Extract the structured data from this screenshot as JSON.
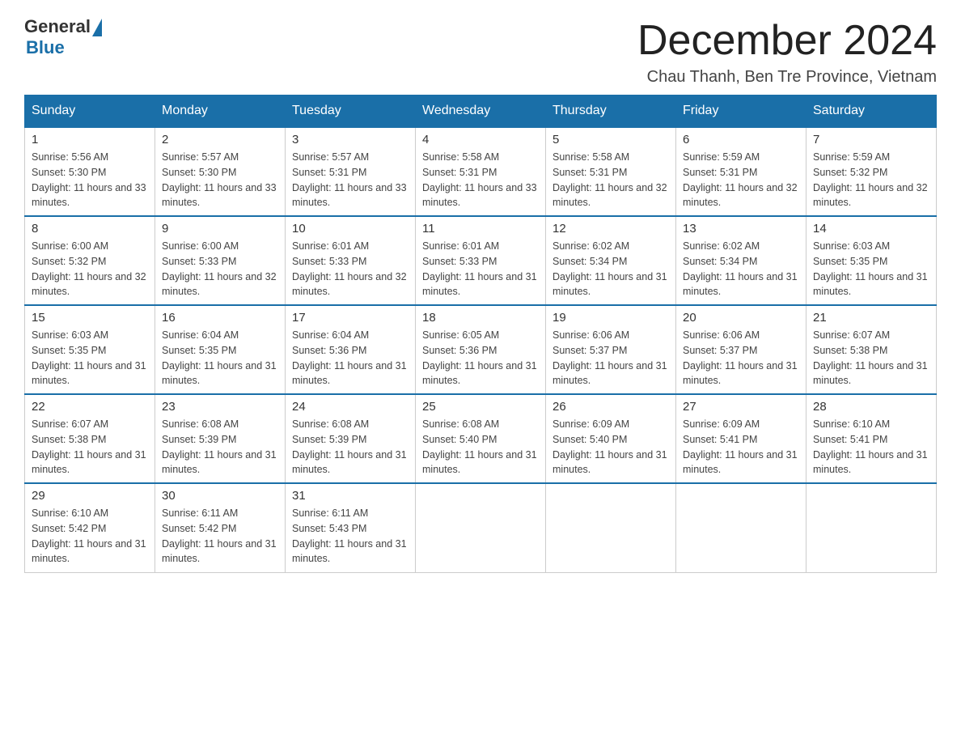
{
  "logo": {
    "general": "General",
    "blue": "Blue"
  },
  "title": "December 2024",
  "subtitle": "Chau Thanh, Ben Tre Province, Vietnam",
  "days_of_week": [
    "Sunday",
    "Monday",
    "Tuesday",
    "Wednesday",
    "Thursday",
    "Friday",
    "Saturday"
  ],
  "weeks": [
    [
      {
        "day": "1",
        "sunrise": "5:56 AM",
        "sunset": "5:30 PM",
        "daylight": "11 hours and 33 minutes."
      },
      {
        "day": "2",
        "sunrise": "5:57 AM",
        "sunset": "5:30 PM",
        "daylight": "11 hours and 33 minutes."
      },
      {
        "day": "3",
        "sunrise": "5:57 AM",
        "sunset": "5:31 PM",
        "daylight": "11 hours and 33 minutes."
      },
      {
        "day": "4",
        "sunrise": "5:58 AM",
        "sunset": "5:31 PM",
        "daylight": "11 hours and 33 minutes."
      },
      {
        "day": "5",
        "sunrise": "5:58 AM",
        "sunset": "5:31 PM",
        "daylight": "11 hours and 32 minutes."
      },
      {
        "day": "6",
        "sunrise": "5:59 AM",
        "sunset": "5:31 PM",
        "daylight": "11 hours and 32 minutes."
      },
      {
        "day": "7",
        "sunrise": "5:59 AM",
        "sunset": "5:32 PM",
        "daylight": "11 hours and 32 minutes."
      }
    ],
    [
      {
        "day": "8",
        "sunrise": "6:00 AM",
        "sunset": "5:32 PM",
        "daylight": "11 hours and 32 minutes."
      },
      {
        "day": "9",
        "sunrise": "6:00 AM",
        "sunset": "5:33 PM",
        "daylight": "11 hours and 32 minutes."
      },
      {
        "day": "10",
        "sunrise": "6:01 AM",
        "sunset": "5:33 PM",
        "daylight": "11 hours and 32 minutes."
      },
      {
        "day": "11",
        "sunrise": "6:01 AM",
        "sunset": "5:33 PM",
        "daylight": "11 hours and 31 minutes."
      },
      {
        "day": "12",
        "sunrise": "6:02 AM",
        "sunset": "5:34 PM",
        "daylight": "11 hours and 31 minutes."
      },
      {
        "day": "13",
        "sunrise": "6:02 AM",
        "sunset": "5:34 PM",
        "daylight": "11 hours and 31 minutes."
      },
      {
        "day": "14",
        "sunrise": "6:03 AM",
        "sunset": "5:35 PM",
        "daylight": "11 hours and 31 minutes."
      }
    ],
    [
      {
        "day": "15",
        "sunrise": "6:03 AM",
        "sunset": "5:35 PM",
        "daylight": "11 hours and 31 minutes."
      },
      {
        "day": "16",
        "sunrise": "6:04 AM",
        "sunset": "5:35 PM",
        "daylight": "11 hours and 31 minutes."
      },
      {
        "day": "17",
        "sunrise": "6:04 AM",
        "sunset": "5:36 PM",
        "daylight": "11 hours and 31 minutes."
      },
      {
        "day": "18",
        "sunrise": "6:05 AM",
        "sunset": "5:36 PM",
        "daylight": "11 hours and 31 minutes."
      },
      {
        "day": "19",
        "sunrise": "6:06 AM",
        "sunset": "5:37 PM",
        "daylight": "11 hours and 31 minutes."
      },
      {
        "day": "20",
        "sunrise": "6:06 AM",
        "sunset": "5:37 PM",
        "daylight": "11 hours and 31 minutes."
      },
      {
        "day": "21",
        "sunrise": "6:07 AM",
        "sunset": "5:38 PM",
        "daylight": "11 hours and 31 minutes."
      }
    ],
    [
      {
        "day": "22",
        "sunrise": "6:07 AM",
        "sunset": "5:38 PM",
        "daylight": "11 hours and 31 minutes."
      },
      {
        "day": "23",
        "sunrise": "6:08 AM",
        "sunset": "5:39 PM",
        "daylight": "11 hours and 31 minutes."
      },
      {
        "day": "24",
        "sunrise": "6:08 AM",
        "sunset": "5:39 PM",
        "daylight": "11 hours and 31 minutes."
      },
      {
        "day": "25",
        "sunrise": "6:08 AM",
        "sunset": "5:40 PM",
        "daylight": "11 hours and 31 minutes."
      },
      {
        "day": "26",
        "sunrise": "6:09 AM",
        "sunset": "5:40 PM",
        "daylight": "11 hours and 31 minutes."
      },
      {
        "day": "27",
        "sunrise": "6:09 AM",
        "sunset": "5:41 PM",
        "daylight": "11 hours and 31 minutes."
      },
      {
        "day": "28",
        "sunrise": "6:10 AM",
        "sunset": "5:41 PM",
        "daylight": "11 hours and 31 minutes."
      }
    ],
    [
      {
        "day": "29",
        "sunrise": "6:10 AM",
        "sunset": "5:42 PM",
        "daylight": "11 hours and 31 minutes."
      },
      {
        "day": "30",
        "sunrise": "6:11 AM",
        "sunset": "5:42 PM",
        "daylight": "11 hours and 31 minutes."
      },
      {
        "day": "31",
        "sunrise": "6:11 AM",
        "sunset": "5:43 PM",
        "daylight": "11 hours and 31 minutes."
      },
      null,
      null,
      null,
      null
    ]
  ]
}
